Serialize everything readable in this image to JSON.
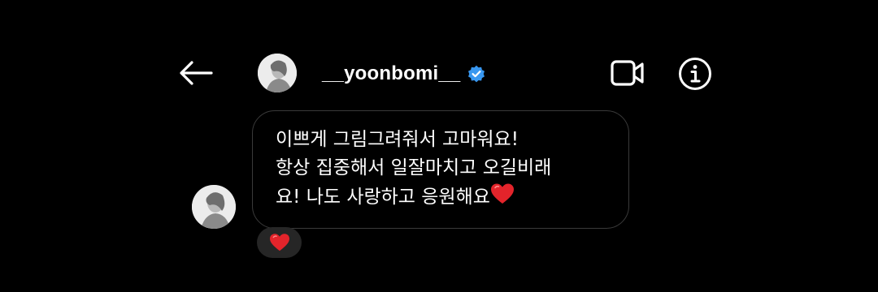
{
  "header": {
    "username": "__yoonbomi__",
    "verified": true,
    "icons": {
      "back": "arrow-left-icon",
      "verified": "verified-badge-icon",
      "video": "video-camera-icon",
      "info": "info-icon"
    }
  },
  "messages": [
    {
      "text": "이쁘게 그림그려줘서 고마워요!\n항상 집중해서 일잘마치고 오길비래\n요! 나도 사랑하고 응원해요",
      "trailing_emoji": "red-heart",
      "reactions": [
        "red-heart"
      ]
    }
  ],
  "colors": {
    "background": "#000000",
    "text": "#ffffff",
    "bubble_border": "#3a3a3a",
    "reaction_bg": "#262626",
    "verified_blue": "#3897f0",
    "heart_red": "#e3242b"
  }
}
